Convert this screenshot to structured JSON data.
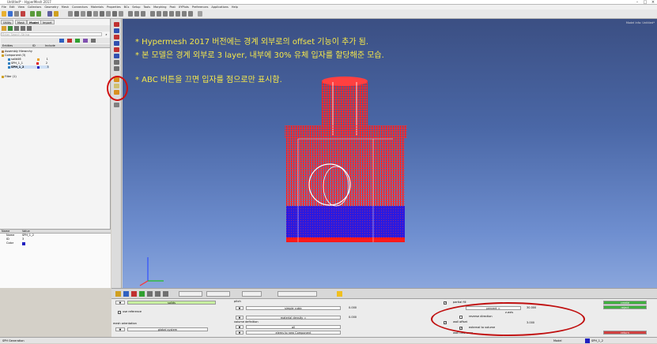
{
  "window": {
    "title": "Untitled* - HyperMesh 2017"
  },
  "menu": [
    "File",
    "Edit",
    "View",
    "Collectors",
    "Geometry",
    "Mesh",
    "Connectors",
    "Materials",
    "Properties",
    "BCs",
    "Setup",
    "Tools",
    "Morphing",
    "Post",
    "XYPlots",
    "Preferences",
    "Applications",
    "Help"
  ],
  "left_panel": {
    "tabs": [
      "Utility",
      "Mask",
      "Model",
      "Import"
    ],
    "search_placeholder": "Enter Search String",
    "header": [
      "Entities",
      "ID",
      "Include"
    ],
    "tree": [
      "Assembly Hierarchy",
      "Component (3)",
      "solid46",
      "SPH_1_1",
      "SPH_1_2",
      "Filter (1)"
    ],
    "tree_ids": [
      "",
      "",
      "1",
      "2",
      "3",
      ""
    ],
    "props_header": [
      "Name",
      "Value"
    ],
    "props": [
      {
        "name": "Name",
        "value": "SPH_1_2"
      },
      {
        "name": "ID",
        "value": "3"
      },
      {
        "name": "Color",
        "value": ""
      }
    ]
  },
  "viewport": {
    "notes": [
      "* Hypermesh 2017 버전에는 경계 외부로의 offset 기능이 추가 됨.",
      "* 본 모델은 경계 외부로 3 layer, 내부에 30% 유체 입자를 할당해준 모습.",
      "* ABC 버튼을 끄면 입자를 점으로만 표시함."
    ],
    "model_info": "Model Info: Untitled*",
    "colors": {
      "particles_outer": "#ff1a1a",
      "particles_fluid": "#2a1ae0",
      "note_text": "#f6e84a"
    }
  },
  "panel": {
    "solids_label": "solids",
    "use_reference": "use reference",
    "pitch_label": "pitch",
    "pitch_value": "0.000",
    "simple_cubic": "simple cubic",
    "material_density": "material density =",
    "density_value": "0.000",
    "volume_definition": "volume definition",
    "all_label": "all",
    "mesh_orientation": "mesh orientation",
    "global_system": "global system",
    "elems_to_component": "elems to new Component",
    "partial_fill": "partial fill",
    "percent": "percent =",
    "percent_value": "30.000",
    "z_axis": "z-axis",
    "reverse_direction": "reverse direction",
    "wall_offset": "wall offset",
    "offset_value": "3.000",
    "external_to_volume": "external to volume",
    "create": "create",
    "reject": "reject",
    "return": "return",
    "wall_clearance": "wall clearance"
  },
  "status": {
    "left": "SPH Generation",
    "mid": "Model",
    "right": "SPH_1_2"
  }
}
